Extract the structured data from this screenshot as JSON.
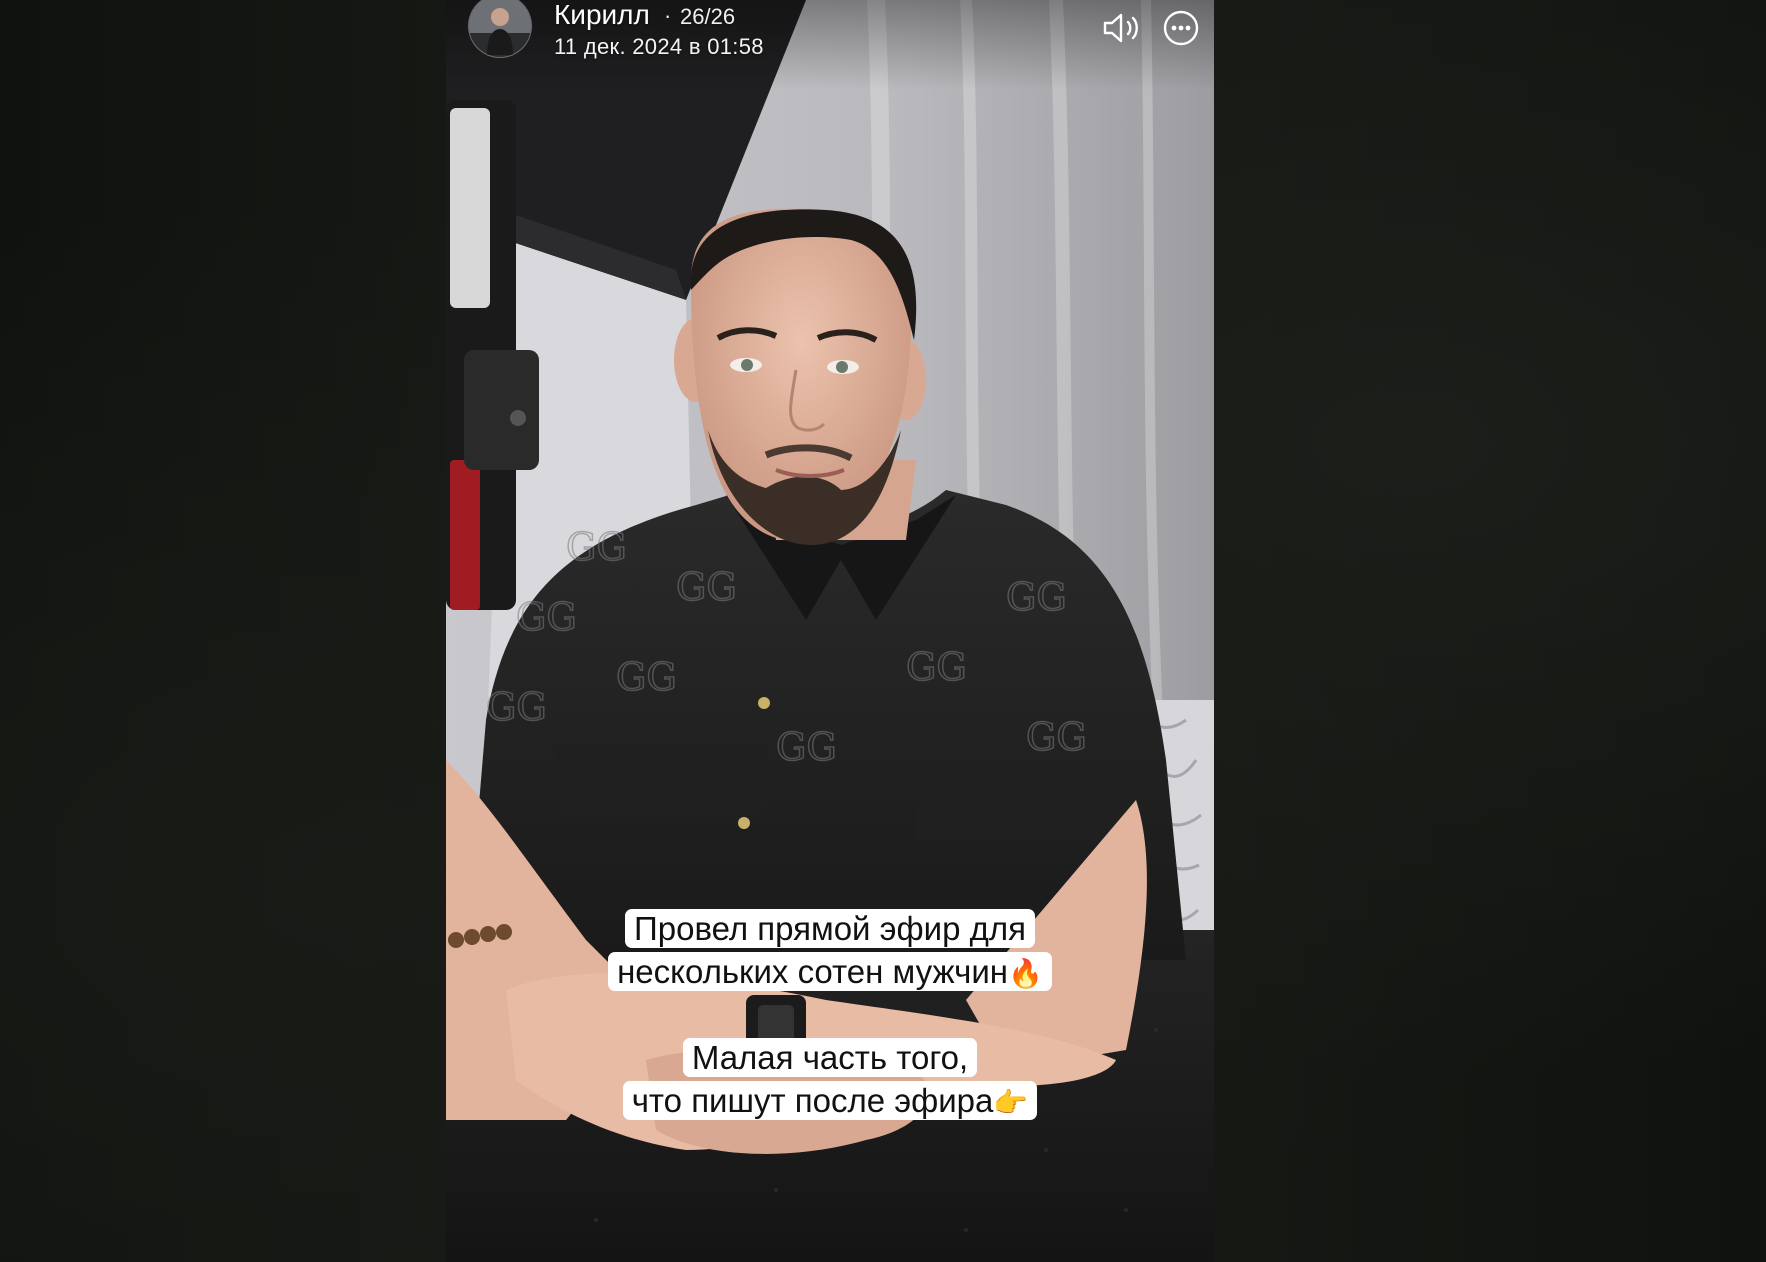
{
  "story": {
    "author": "Кирилл",
    "separator": "·",
    "counter": "26/26",
    "timestamp": "11 дек. 2024 в 01:58"
  },
  "controls": {
    "sound_icon": "speaker-icon",
    "more_icon": "more-options-icon"
  },
  "captions": {
    "first": {
      "line1": "Провел прямой эфир для",
      "line2": "нескольких сотен мужчин",
      "line2_emoji": "🔥"
    },
    "second": {
      "line1": "Малая часть того,",
      "line2": "что пишут после эфира",
      "line2_emoji": "👉"
    }
  },
  "colors": {
    "backdrop": "#121411",
    "caption_bg": "#ffffff",
    "caption_text": "#111111"
  }
}
